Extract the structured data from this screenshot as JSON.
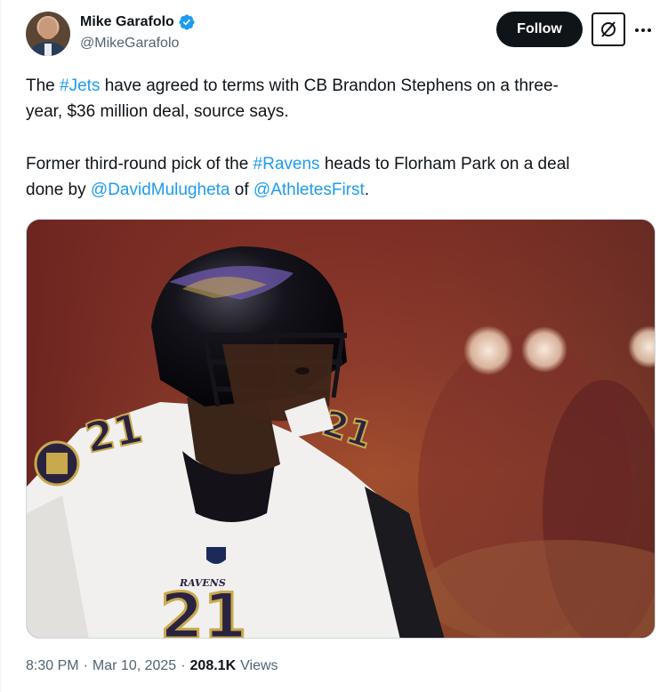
{
  "author": {
    "display_name": "Mike Garafolo",
    "handle": "@MikeGarafolo",
    "verified": true
  },
  "actions": {
    "follow_label": "Follow",
    "grok_icon": "slash-square-icon",
    "more_icon": "more-horizontal-icon"
  },
  "body": {
    "p1_pre": "The ",
    "p1_tag_jets": "#Jets",
    "p1_line1_rest": " have agreed to terms with CB Brandon Stephens on a three-",
    "p1_line2": "year, $36 million deal, source says.",
    "p2_pre": "Former third-round pick of the ",
    "p2_tag_ravens": "#Ravens",
    "p2_mid": " heads to Florham Park on a deal",
    "p2_line2_pre": "done by ",
    "p2_mention1": "@DavidMulugheta",
    "p2_of": " of ",
    "p2_mention2": "@AthletesFirst",
    "p2_end": "."
  },
  "media": {
    "jersey_number": "21",
    "jersey_text": "RAVENS"
  },
  "meta": {
    "time": "8:30 PM",
    "sep": "·",
    "date": "Mar 10, 2025",
    "views_count": "208.1K",
    "views_label": "Views"
  },
  "colors": {
    "link": "#1d9bf0",
    "verified": "#1d9bf0",
    "text": "#0f1419",
    "secondary": "#536471"
  }
}
